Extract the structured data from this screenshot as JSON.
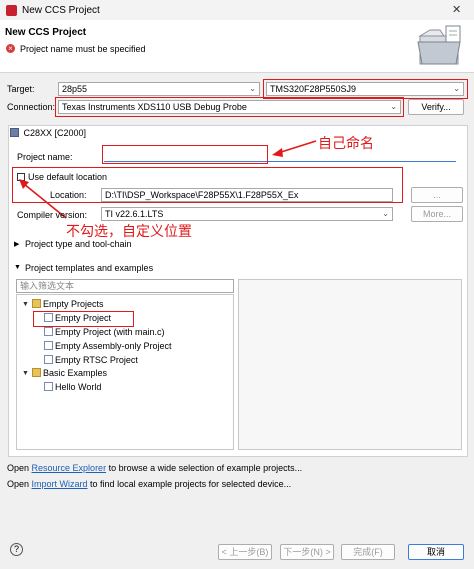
{
  "window": {
    "title": "New CCS Project",
    "close_glyph": "✕"
  },
  "header": {
    "title": "New CCS Project",
    "message": "Project name must be specified",
    "error_glyph": "×"
  },
  "target": {
    "label": "Target:",
    "family": "28p55",
    "device": "TMS320F28P550SJ9"
  },
  "connection": {
    "label": "Connection:",
    "value": "Texas Instruments XDS110 USB Debug Probe",
    "verify_label": "Verify..."
  },
  "tab": {
    "label": "C28XX [C2000]"
  },
  "project_name": {
    "label": "Project name:",
    "value": ""
  },
  "default_location": {
    "label": "Use default location",
    "checked": false
  },
  "location": {
    "label": "Location:",
    "value": "D:\\TI\\DSP_Workspace\\F28P55X\\1.F28P55X_Ex",
    "browse_label": "..."
  },
  "compiler": {
    "label": "Compiler version:",
    "value": "TI v22.6.1.LTS",
    "more_label": "More..."
  },
  "sections": {
    "type_toolchain": "Project type and tool-chain",
    "templates": "Project templates and examples"
  },
  "filter": {
    "placeholder": "输入筛选文本"
  },
  "tree": {
    "empty_projects": "Empty Projects",
    "items": [
      "Empty Project",
      "Empty Project (with main.c)",
      "Empty Assembly-only Project",
      "Empty RTSC Project"
    ],
    "basic_examples": "Basic Examples",
    "basic_items": [
      "Hello World"
    ]
  },
  "annotations": {
    "name_note": "自己命名",
    "location_note": "不勾选，自定义位置"
  },
  "bottom_links": {
    "line1_prefix": "Open ",
    "line1_link": "Resource Explorer",
    "line1_suffix": " to browse a wide selection of example projects...",
    "line2_prefix": "Open ",
    "line2_link": "Import Wizard",
    "line2_suffix": " to find local example projects for selected device..."
  },
  "buttons": {
    "help": "?",
    "back": "< 上一步(B)",
    "next": "下一步(N) >",
    "finish": "完成(F)",
    "cancel": "取消"
  },
  "colors": {
    "annotation": "#e01a1a",
    "link": "#1c5fb3",
    "focus": "#3d7bd9"
  }
}
